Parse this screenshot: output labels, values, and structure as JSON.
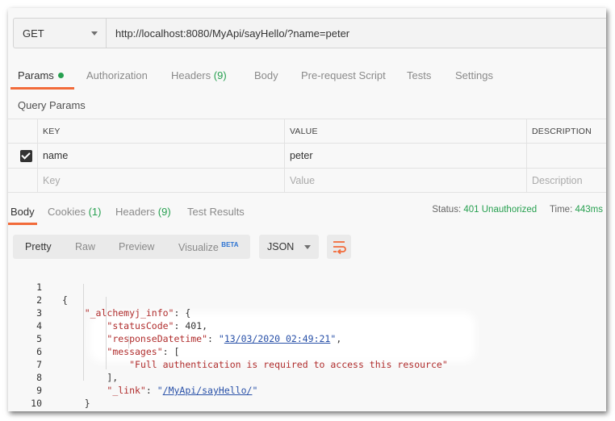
{
  "request": {
    "method": "GET",
    "url": "http://localhost:8080/MyApi/sayHello/?name=peter"
  },
  "request_tabs": [
    {
      "label": "Params",
      "count": "",
      "dot": true
    },
    {
      "label": "Authorization",
      "count": ""
    },
    {
      "label": "Headers",
      "count": "(9)"
    },
    {
      "label": "Body",
      "count": ""
    },
    {
      "label": "Pre-request Script",
      "count": ""
    },
    {
      "label": "Tests",
      "count": ""
    },
    {
      "label": "Settings",
      "count": ""
    }
  ],
  "query_params": {
    "title": "Query Params",
    "headers": {
      "key": "KEY",
      "value": "VALUE",
      "description": "DESCRIPTION"
    },
    "rows": [
      {
        "checked": true,
        "key": "name",
        "value": "peter",
        "description": ""
      }
    ],
    "placeholder": {
      "key": "Key",
      "value": "Value",
      "description": "Description"
    }
  },
  "response_tabs": [
    {
      "label": "Body",
      "count": ""
    },
    {
      "label": "Cookies",
      "count": "(1)"
    },
    {
      "label": "Headers",
      "count": "(9)"
    },
    {
      "label": "Test Results",
      "count": ""
    }
  ],
  "status": {
    "status_label": "Status:",
    "status_value": "401 Unauthorized",
    "time_label": "Time:",
    "time_value": "443ms"
  },
  "view_modes": [
    "Pretty",
    "Raw",
    "Preview",
    "Visualize"
  ],
  "beta_label": "BETA",
  "format": "JSON",
  "code_lines": [
    {
      "n": "1"
    },
    {
      "n": "2"
    },
    {
      "n": "3"
    },
    {
      "n": "4"
    },
    {
      "n": "5"
    },
    {
      "n": "6"
    },
    {
      "n": "7"
    },
    {
      "n": "8"
    },
    {
      "n": "9"
    },
    {
      "n": "10"
    }
  ],
  "json_body": {
    "open_brace": "{",
    "info_key": "\"_alchemyj_info\"",
    "status_code_key": "\"statusCode\"",
    "status_code_value": "401",
    "response_datetime_key": "\"responseDatetime\"",
    "response_datetime_value": "13/03/2020 02:49:21",
    "messages_key": "\"messages\"",
    "message": "\"Full authentication is required to access this resource\"",
    "link_key": "\"_link\"",
    "link_value": "/MyApi/sayHello/",
    "close_brace": "}"
  },
  "colors": {
    "accent": "#f26b3a",
    "success": "#27a050",
    "json_key": "#b02d2d",
    "json_string": "#2850a8"
  },
  "icons": [
    "method-dropdown-caret-icon",
    "checkbox-checked-icon",
    "format-dropdown-caret-icon",
    "wrap-lines-icon"
  ]
}
